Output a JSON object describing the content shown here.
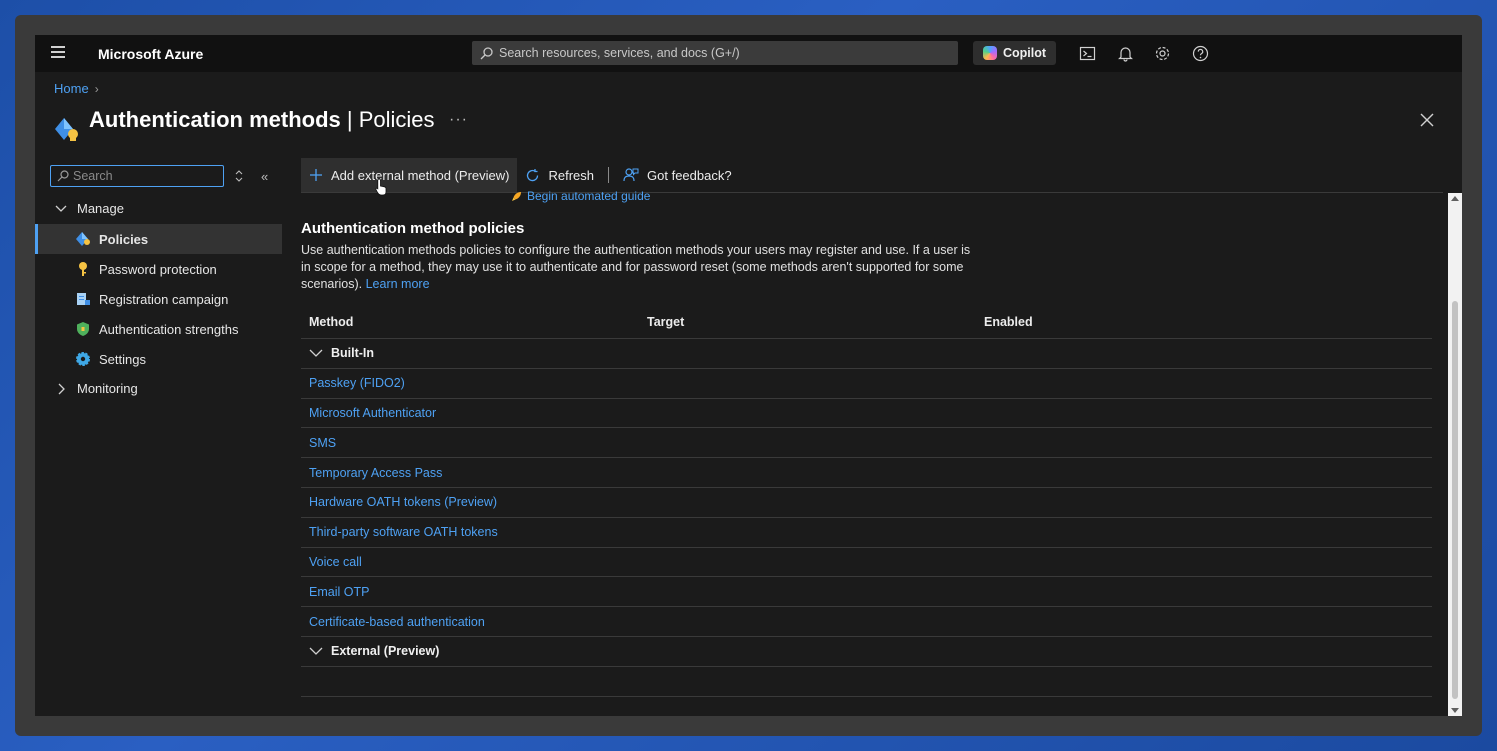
{
  "topbar": {
    "brand": "Microsoft Azure",
    "search_placeholder": "Search resources, services, and docs (G+/)",
    "copilot_label": "Copilot"
  },
  "breadcrumb": {
    "home": "Home"
  },
  "page": {
    "title_main": "Authentication methods",
    "title_sep": " | ",
    "title_sub": "Policies",
    "more": "···"
  },
  "nav": {
    "search_placeholder": "Search",
    "collapse": "«",
    "groups": {
      "manage": "Manage",
      "monitoring": "Monitoring"
    },
    "items": [
      {
        "label": "Policies"
      },
      {
        "label": "Password protection"
      },
      {
        "label": "Registration campaign"
      },
      {
        "label": "Authentication strengths"
      },
      {
        "label": "Settings"
      }
    ]
  },
  "toolbar": {
    "add_label": "Add external method (Preview)",
    "refresh_label": "Refresh",
    "feedback_label": "Got feedback?"
  },
  "content": {
    "guide_link": "Begin automated guide",
    "section_title": "Authentication method policies",
    "description": "Use authentication methods policies to configure the authentication methods your users may register and use. If a user is in scope for a method, they may use it to authenticate and for password reset (some methods aren't supported for some scenarios). ",
    "learn_more": "Learn more"
  },
  "table": {
    "columns": {
      "method": "Method",
      "target": "Target",
      "enabled": "Enabled"
    },
    "groups": {
      "builtin": "Built-In",
      "external": "External (Preview)"
    },
    "methods": [
      "Passkey (FIDO2)",
      "Microsoft Authenticator",
      "SMS",
      "Temporary Access Pass",
      "Hardware OATH tokens (Preview)",
      "Third-party software OATH tokens",
      "Voice call",
      "Email OTP",
      "Certificate-based authentication"
    ]
  },
  "colors": {
    "accent": "#4ea1f3",
    "background": "#1b1b1b",
    "topbar": "#111111"
  }
}
